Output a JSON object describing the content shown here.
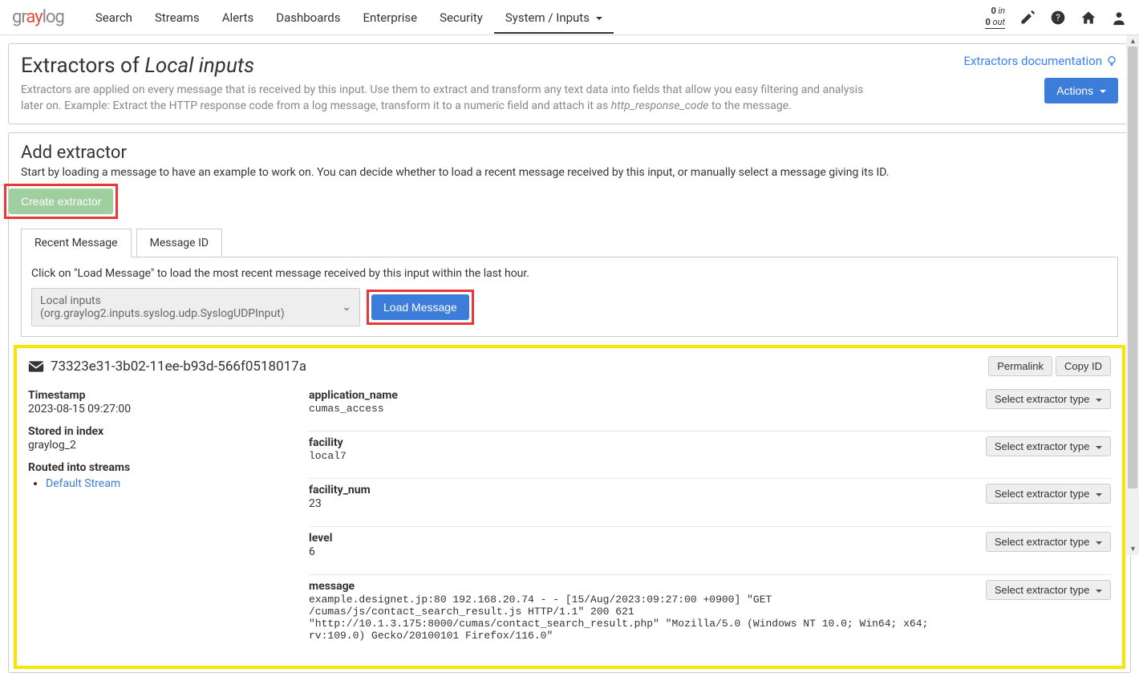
{
  "nav": {
    "logo_parts": [
      "gr",
      "ay",
      "log"
    ],
    "items": [
      "Search",
      "Streams",
      "Alerts",
      "Dashboards",
      "Enterprise",
      "Security",
      "System / Inputs"
    ],
    "throughput_in_num": "0",
    "throughput_in_label": "in",
    "throughput_out_num": "0",
    "throughput_out_label": "out"
  },
  "header": {
    "title_prefix": "Extractors of ",
    "title_em": "Local inputs",
    "desc_1": "Extractors are applied on every message that is received by this input. Use them to extract and transform any text data into fields that allow you easy filtering and analysis later on. Example: Extract the HTTP response code from a log message, transform it to a numeric field and attach it as ",
    "desc_em": "http_response_code",
    "desc_2": " to the message.",
    "doclink": "Extractors documentation",
    "actions_btn": "Actions"
  },
  "add": {
    "title": "Add extractor",
    "desc": "Start by loading a message to have an example to work on. You can decide whether to load a recent message received by this input, or manually select a message giving its ID.",
    "create_btn": "Create extractor",
    "tabs": [
      "Recent Message",
      "Message ID"
    ],
    "tab_help": "Click on \"Load Message\" to load the most recent message received by this input within the last hour.",
    "input_select": "Local inputs (org.graylog2.inputs.syslog.udp.SyslogUDPInput)",
    "load_btn": "Load Message"
  },
  "msg": {
    "id": "73323e31-3b02-11ee-b93d-566f0518017a",
    "permalink": "Permalink",
    "copyid": "Copy ID",
    "left": {
      "timestamp_label": "Timestamp",
      "timestamp_value": "2023-08-15 09:27:00",
      "index_label": "Stored in index",
      "index_value": "graylog_2",
      "streams_label": "Routed into streams",
      "stream_link": "Default Stream"
    },
    "fields": [
      {
        "name": "application_name",
        "value": "cumas_access",
        "mono": true
      },
      {
        "name": "facility",
        "value": "local7",
        "mono": true
      },
      {
        "name": "facility_num",
        "value": "23",
        "mono": false
      },
      {
        "name": "level",
        "value": "6",
        "mono": false
      },
      {
        "name": "message",
        "value": "example.designet.jp:80 192.168.20.74 - - [15/Aug/2023:09:27:00 +0900] \"GET /cumas/js/contact_search_result.js HTTP/1.1\" 200 621 \"http://10.1.3.175:8000/cumas/contact_search_result.php\" \"Mozilla/5.0 (Windows NT 10.0; Win64; x64; rv:109.0) Gecko/20100101 Firefox/116.0\"",
        "mono": true
      }
    ],
    "select_extractor": "Select extractor type"
  }
}
